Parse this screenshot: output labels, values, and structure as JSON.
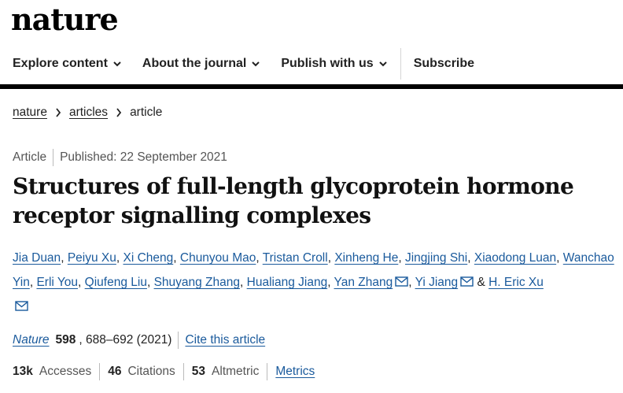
{
  "logo": "nature",
  "nav": {
    "items": [
      "Explore content",
      "About the journal",
      "Publish with us"
    ],
    "subscribe": "Subscribe"
  },
  "breadcrumb": [
    "nature",
    "articles",
    "article"
  ],
  "meta": {
    "type": "Article",
    "published": "Published: 22 September 2021"
  },
  "title": "Structures of full-length glycoprotein hormone receptor signalling complexes",
  "authors": [
    "Jia Duan",
    "Peiyu Xu",
    "Xi Cheng",
    "Chunyou Mao",
    "Tristan Croll",
    "Xinheng He",
    "Jingjing Shi",
    "Xiaodong Luan",
    "Wanchao Yin",
    "Erli You",
    "Qiufeng Liu",
    "Shuyang Zhang",
    "Hualiang Jiang",
    "Yan Zhang",
    "Yi Jiang",
    "H. Eric Xu"
  ],
  "authors_sep": ", ",
  "authors_and": " & ",
  "citation": {
    "journal": "Nature",
    "volume": "598",
    "pages": ", 688–692 (2021)",
    "cite_link": "Cite this article"
  },
  "metrics": {
    "accesses_value": "13k",
    "accesses_label": "Accesses",
    "citations_value": "46",
    "citations_label": "Citations",
    "altmetric_value": "53",
    "altmetric_label": "Altmetric",
    "metrics_link": "Metrics"
  },
  "colors": {
    "link": "#1a5a9c",
    "nav_bar": "#000000"
  },
  "icons": {
    "chevron": "chevron-down-icon",
    "breadcrumb_sep": "chevron-right-icon",
    "mail": "mail-icon"
  }
}
